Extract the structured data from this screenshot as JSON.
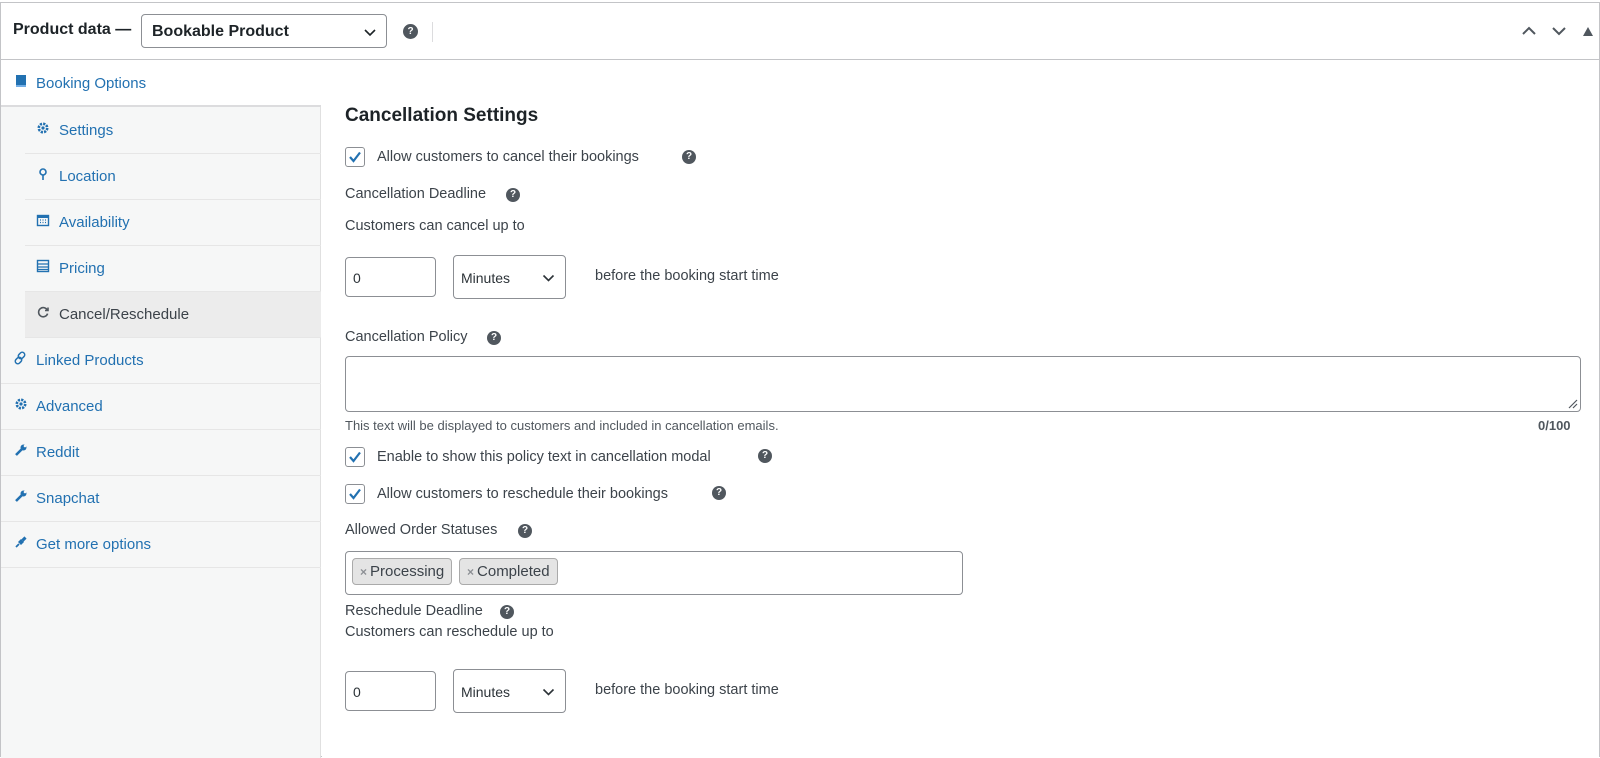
{
  "header": {
    "title": "Product data —",
    "product_type": "Bookable Product"
  },
  "sidebar": {
    "items": [
      {
        "label": "Booking Options",
        "icon": "book-icon"
      },
      {
        "label": "Settings",
        "icon": "gear-icon"
      },
      {
        "label": "Location",
        "icon": "location-pin-icon"
      },
      {
        "label": "Availability",
        "icon": "calendar-icon"
      },
      {
        "label": "Pricing",
        "icon": "list-icon"
      },
      {
        "label": "Cancel/Reschedule",
        "icon": "refresh-icon"
      },
      {
        "label": "Linked Products",
        "icon": "link-icon"
      },
      {
        "label": "Advanced",
        "icon": "gear-icon"
      },
      {
        "label": "Reddit",
        "icon": "wrench-icon"
      },
      {
        "label": "Snapchat",
        "icon": "wrench-icon"
      },
      {
        "label": "Get more options",
        "icon": "plugin-icon"
      }
    ]
  },
  "main": {
    "section_title": "Cancellation Settings",
    "allow_cancel_label": "Allow customers to cancel their bookings",
    "cancellation_deadline_label": "Cancellation Deadline",
    "cancel_up_to_text": "Customers can cancel up to",
    "cancel_value": "0",
    "cancel_unit": "Minutes",
    "before_start_text": "before the booking start time",
    "policy_label": "Cancellation Policy",
    "policy_help_text": "This text will be displayed to customers and included in cancellation emails.",
    "policy_counter": "0/100",
    "show_policy_label": "Enable to show this policy text in cancellation modal",
    "allow_reschedule_label": "Allow customers to reschedule their bookings",
    "allowed_statuses_label": "Allowed Order Statuses",
    "statuses": [
      "Processing",
      "Completed"
    ],
    "reschedule_deadline_label": "Reschedule Deadline",
    "reschedule_up_to_text": "Customers can reschedule up to",
    "reschedule_value": "0",
    "reschedule_unit": "Minutes",
    "reschedule_before_text": "before the booking start time"
  },
  "colors": {
    "link": "#2271b1",
    "active_bg": "#ececec",
    "sidebar_bg": "#f6f7f7"
  }
}
